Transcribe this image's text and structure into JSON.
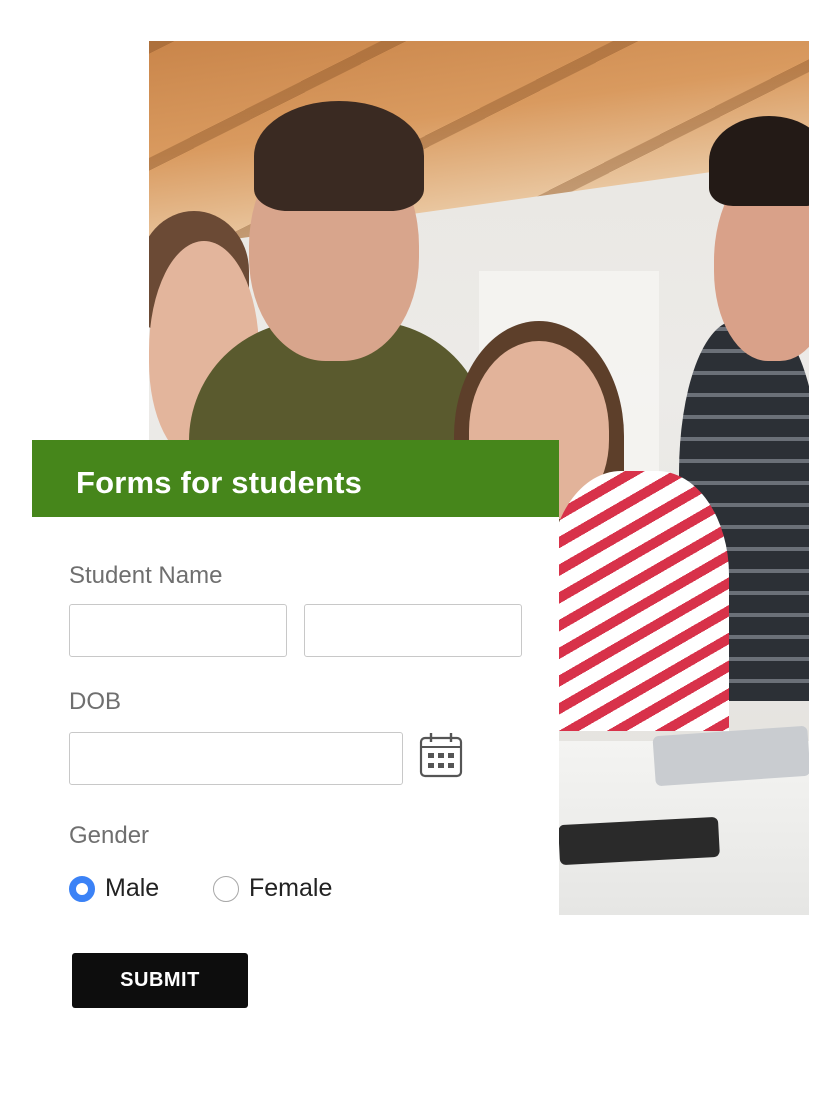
{
  "form": {
    "title": "Forms for students",
    "student_name_label": "Student Name",
    "first_name_value": "",
    "last_name_value": "",
    "dob_label": "DOB",
    "dob_value": "",
    "gender_label": "Gender",
    "gender_options": [
      {
        "label": "Male",
        "selected": true
      },
      {
        "label": "Female",
        "selected": false
      }
    ],
    "submit_label": "SUBMIT"
  },
  "colors": {
    "header_green": "#46861b",
    "radio_selected": "#3b82f6",
    "submit_bg": "#0d0d0d"
  },
  "icons": [
    "calendar-icon"
  ]
}
